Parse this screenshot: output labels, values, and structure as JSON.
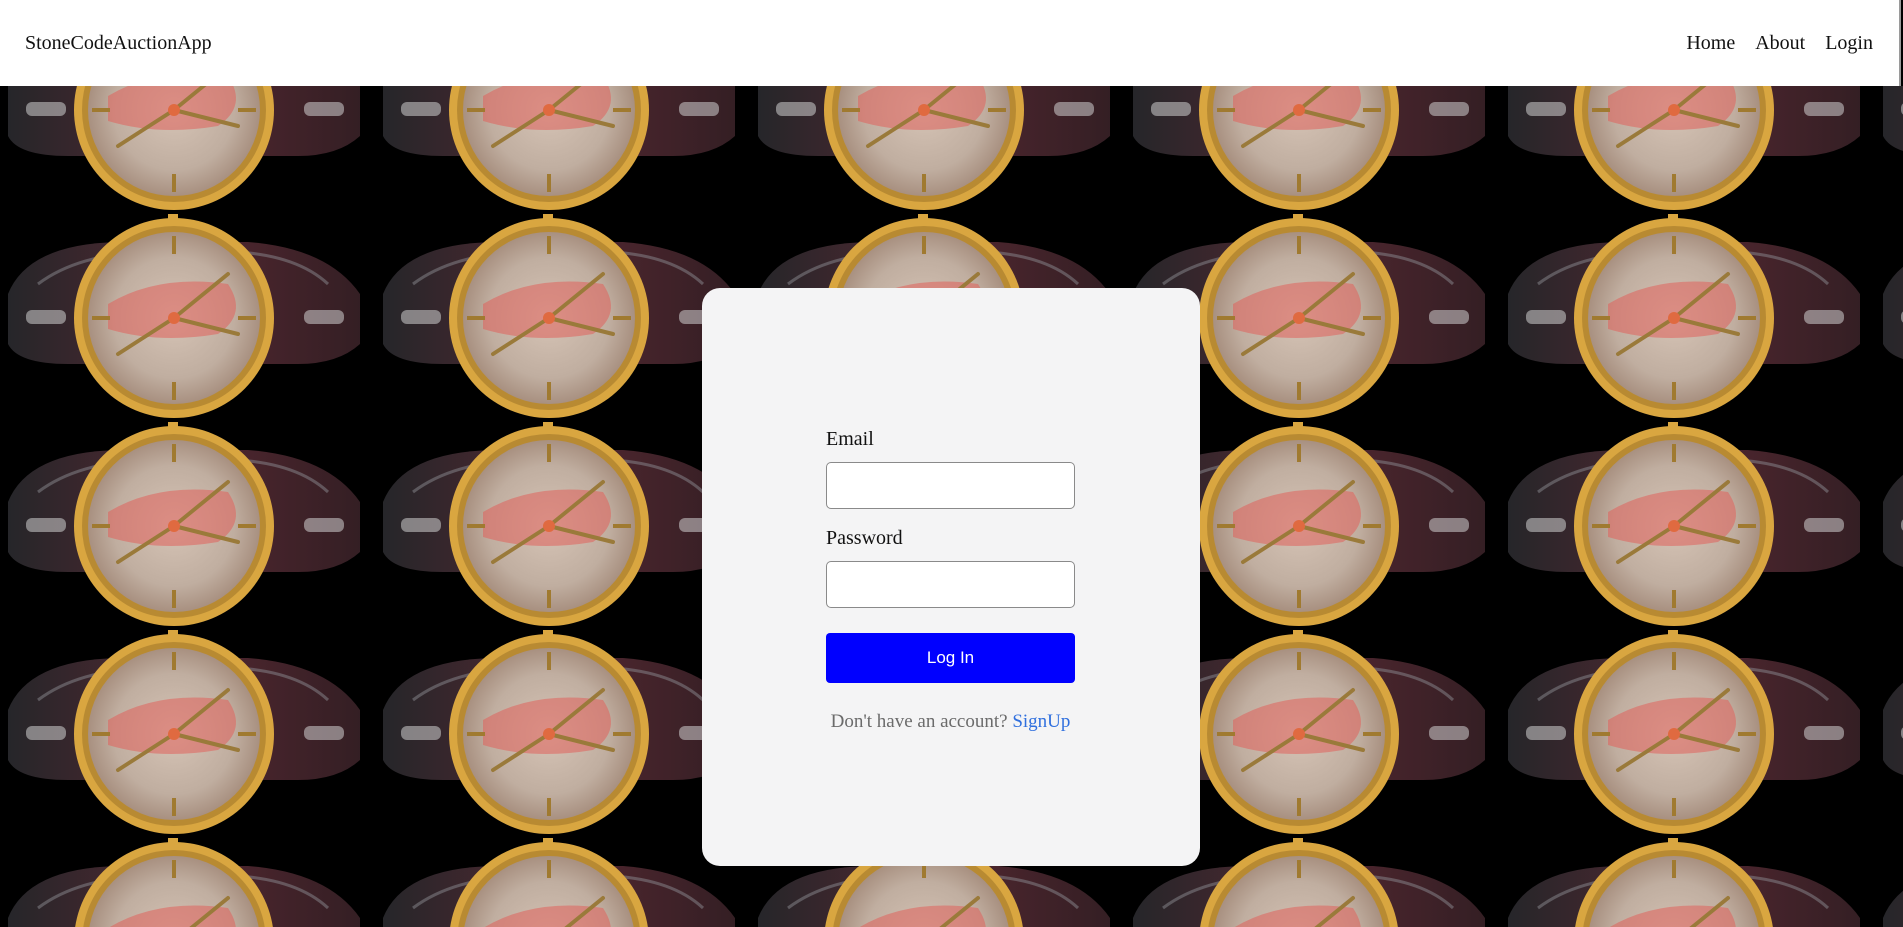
{
  "nav": {
    "brand": "StoneCodeAuctionApp",
    "links": [
      {
        "label": "Home"
      },
      {
        "label": "About"
      },
      {
        "label": "Login"
      }
    ]
  },
  "background": {
    "description_icon": "watch-over-car-pattern",
    "colors": {
      "base": "#000000",
      "gold": "#d9a640",
      "car": "#5a2a33",
      "face": "#c9b7a8",
      "red": "#e0605a"
    }
  },
  "login_form": {
    "email_label": "Email",
    "email_value": "",
    "password_label": "Password",
    "password_value": "",
    "submit_label": "Log In",
    "signup_prompt": "Don't have an account?",
    "signup_link": "SignUp"
  },
  "colors": {
    "card_bg": "#f4f4f5",
    "button_bg": "#0000ff",
    "link": "#2f6fde"
  }
}
